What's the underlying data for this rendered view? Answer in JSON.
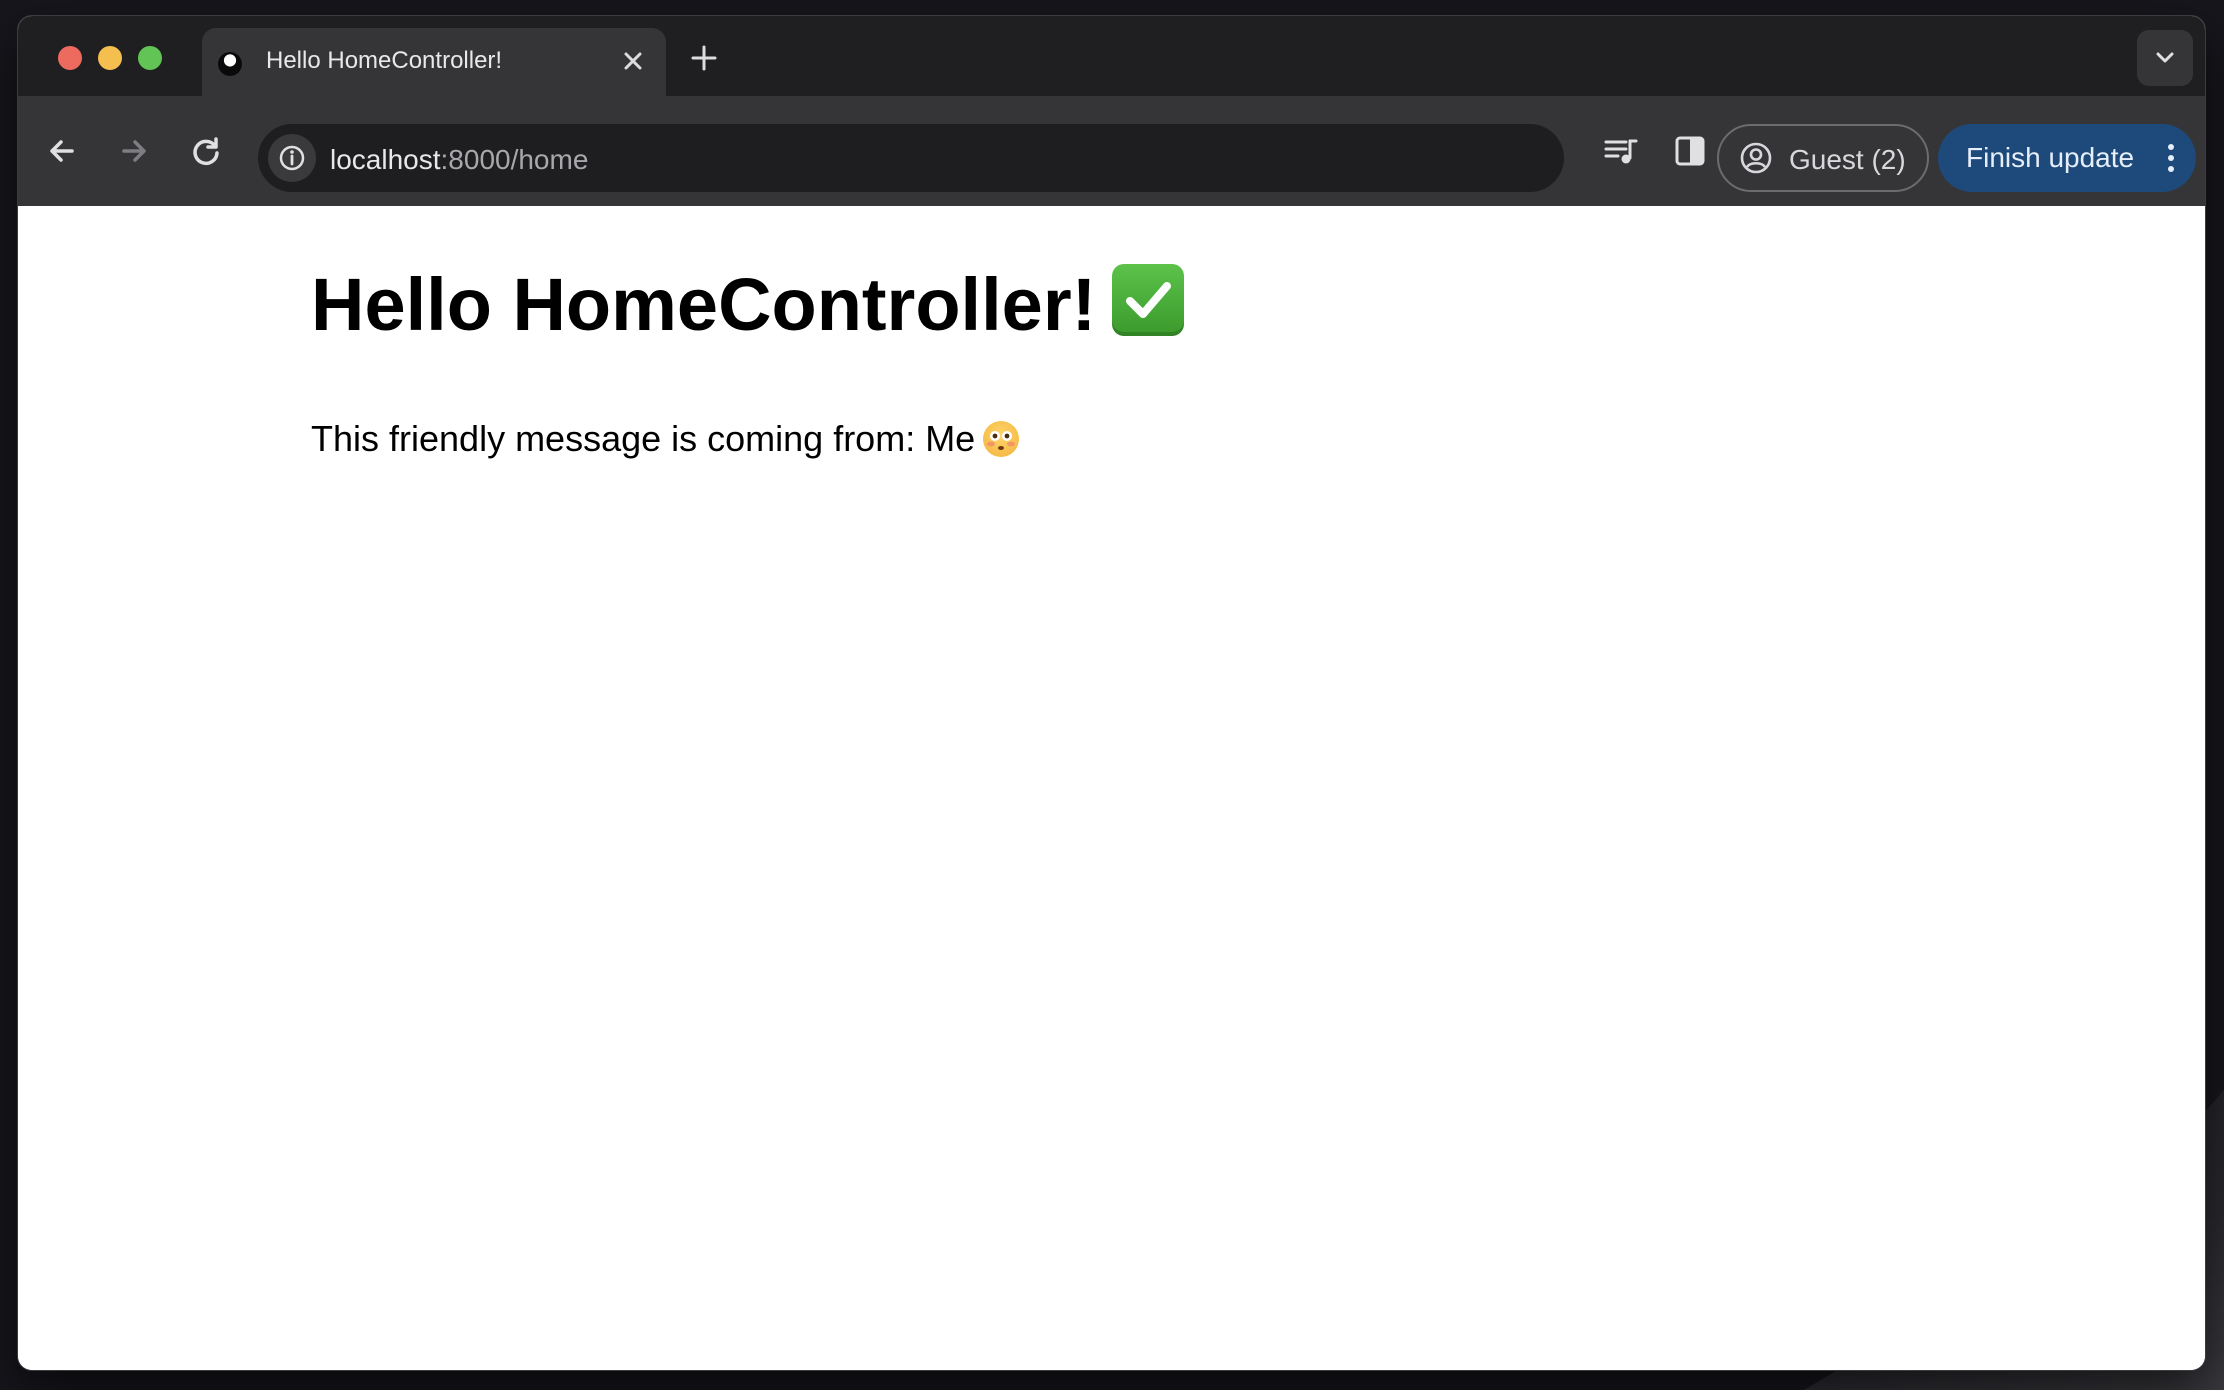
{
  "browser": {
    "tab": {
      "title": "Hello HomeController!"
    },
    "address_bar": {
      "host": "localhost",
      "path": ":8000/home"
    },
    "profile": {
      "label": "Guest (2)"
    },
    "update_button": {
      "label": "Finish update"
    }
  },
  "page": {
    "heading": "Hello HomeController!",
    "message": "This friendly message is coming from: Me"
  },
  "colors": {
    "update_button_bg": "#1d4a7a",
    "toolbar_bg": "#353538",
    "tabstrip_bg": "#1f1f21"
  },
  "icons": [
    "close-icon",
    "plus-icon",
    "chevron-down-icon",
    "back-arrow-icon",
    "forward-arrow-icon",
    "reload-icon",
    "info-icon",
    "media-queue-icon",
    "side-panel-icon",
    "profile-icon",
    "more-vert-icon",
    "check-mark-emoji",
    "flushed-face-emoji"
  ]
}
